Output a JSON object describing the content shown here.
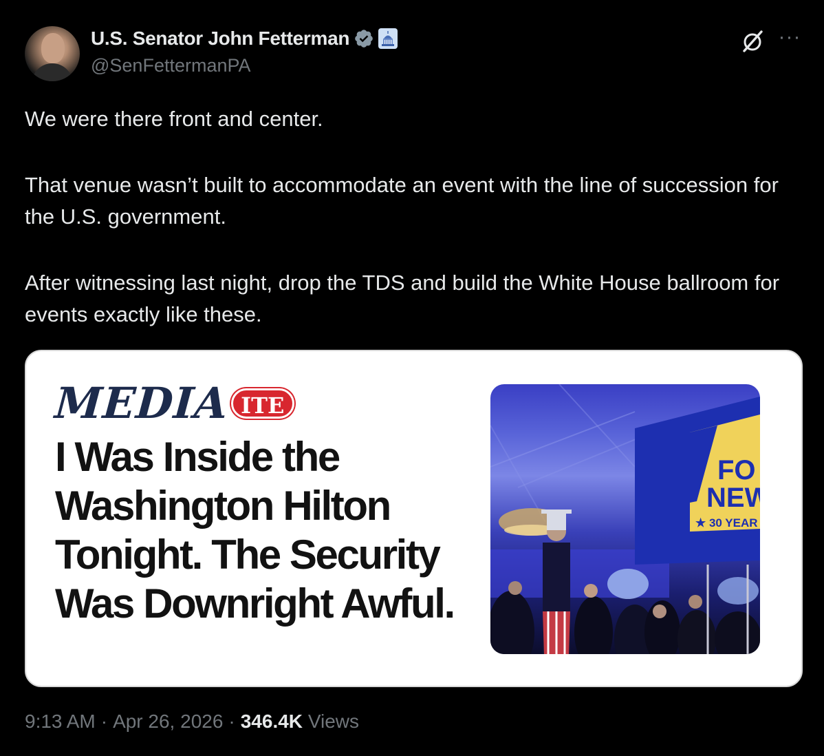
{
  "author": {
    "display_name": "U.S. Senator John Fetterman",
    "handle": "@SenFettermanPA"
  },
  "tweet": {
    "paragraphs": [
      "We were there front and center.",
      "That venue wasn’t built to accommodate an event with the line of succession for the U.S. government.",
      "After witnessing last night, drop the TDS and build the White House ballroom for events exactly like these."
    ]
  },
  "card": {
    "brand_main": "MEDIA",
    "brand_badge": "ITE",
    "headline": "I Was Inside the Washington Hilton Tonight. The Security Was Downright Awful.",
    "photo_sign_line1": "FO",
    "photo_sign_line2": "NEW",
    "photo_sign_line3": "★ 30 YEAR"
  },
  "meta": {
    "time": "9:13 AM",
    "separator": "·",
    "date": "Apr 26, 2026",
    "views_count": "346.4K",
    "views_label": "Views"
  },
  "icons": {
    "verified": "verified-badge-icon",
    "affiliate": "capitol-icon",
    "grok": "grok-icon",
    "more": "more-icon"
  },
  "colors": {
    "background": "#000000",
    "text": "#e7e9ea",
    "muted": "#71767b",
    "brand_navy": "#1d2b4c",
    "brand_red": "#d8272f"
  }
}
